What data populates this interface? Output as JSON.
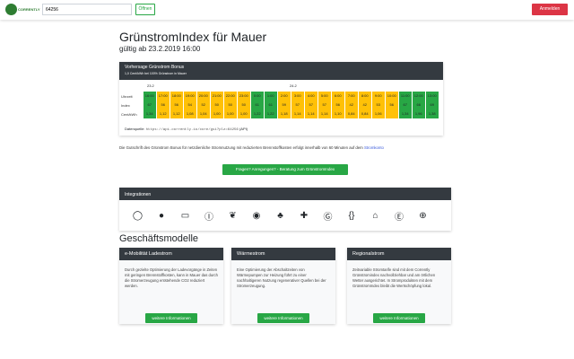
{
  "header": {
    "logo_text": "CORRENTLY",
    "search_value": "64256",
    "search_button": "Öffnen",
    "login_button": "Anmelden"
  },
  "page": {
    "title": "GrünstromIndex für Mauer",
    "subtitle": "gültig ab 23.2.2019 16:00"
  },
  "forecast": {
    "title": "Vorhersage Grünstrom Bonus",
    "subtitle": "1,0 Cent/kWh bei 100% Grünstrom in Mauer",
    "date1": "23.2",
    "date2": "24.2",
    "row_labels": [
      "Uhrzeit",
      "Index",
      "Cent/kWh"
    ],
    "hours": [
      "16:00",
      "17:00",
      "18:00",
      "19:00",
      "20:00",
      "21:00",
      "22:00",
      "23:00",
      "0:00",
      "1:00",
      "2:00",
      "3:00",
      "4:00",
      "5:00",
      "6:00",
      "7:00",
      "8:00",
      "9:00",
      "10:00",
      "11:00",
      "12:00",
      "13:00"
    ],
    "index": [
      "67",
      "56",
      "56",
      "54",
      "52",
      "50",
      "50",
      "50",
      "61",
      "61",
      "59",
      "57",
      "57",
      "57",
      "56",
      "42",
      "42",
      "53",
      "56",
      "67",
      "66",
      "69"
    ],
    "cents": [
      "1,34",
      "1,12",
      "1,12",
      "1,08",
      "1,04",
      "1,00",
      "1,00",
      "1,00",
      "1,22",
      "1,22",
      "1,18",
      "1,14",
      "1,14",
      "1,14",
      "1,10",
      "0,84",
      "0,84",
      "1,06",
      "",
      "1,34",
      "1,96",
      "1,38"
    ],
    "colors": [
      "#28a745",
      "#ffc107",
      "#ffc107",
      "#ffc107",
      "#ffc107",
      "#ffc107",
      "#ffc107",
      "#ffc107",
      "#28a745",
      "#28a745",
      "#ffc107",
      "#ffc107",
      "#ffc107",
      "#ffc107",
      "#ffc107",
      "#ffc107",
      "#ffc107",
      "#ffc107",
      "#ffc107",
      "#28a745",
      "#28a745",
      "#28a745"
    ],
    "source_label": "Datenquelle:",
    "source_url": "https://api.corrently.io/core/gsi?plz=64256",
    "source_api": "(API)"
  },
  "description": {
    "text": "Die Gutschrift des Grünstrom Bonus für netzdienliche Stromnutzung mit reduzierten Brennstoffkosten erfolgt innerhalb von 60 Minuten auf dem",
    "link": "Stromkonto"
  },
  "feedback_button": "Fragen? Anregungen? - Beratung zum GrünstromIndex",
  "integrations": {
    "title": "Integrationen",
    "icons": [
      "alexa-icon",
      "cortana-icon",
      "ifttt-icon",
      "iobroker-icon",
      "node-red-icon",
      "chrome-icon",
      "piggy-bank-icon",
      "puzzle-icon",
      "corrently-icon",
      "code-icon",
      "smart-home-icon",
      "openhab-icon",
      "add-icon"
    ]
  },
  "section_title": "Geschäftsmodelle",
  "cards": [
    {
      "title": "e-Mobilität Ladestrom",
      "body": "Durch gezielte Optimierung der Ladevorgänge in Zeiten mit geringen Brennstoffkosten, kann in Mauer das durch die Stromerzeugung entstehende CO2 reduziert werden.",
      "button": "weitere Informationen"
    },
    {
      "title": "Wärmestrom",
      "body": "Eine Optimierung der Abschaltzeiten von Wärmepumpen zur Heizung führt zu einer nachhaltigeren Nutzung regenerativer Quellen bei der Stromerzeugung.",
      "button": "weitere Informationen"
    },
    {
      "title": "Regionalstrom",
      "body": "Zeitvariable Stromtarife sind mit dem Corrently Grünstromindex nachvollziehbar und am örtlichen Wetter ausgerichtet. In Stromprodukten mit dem GrünstromIndex bleibt die Wertschöpfung lokal.",
      "button": "weitere Informationen"
    }
  ]
}
